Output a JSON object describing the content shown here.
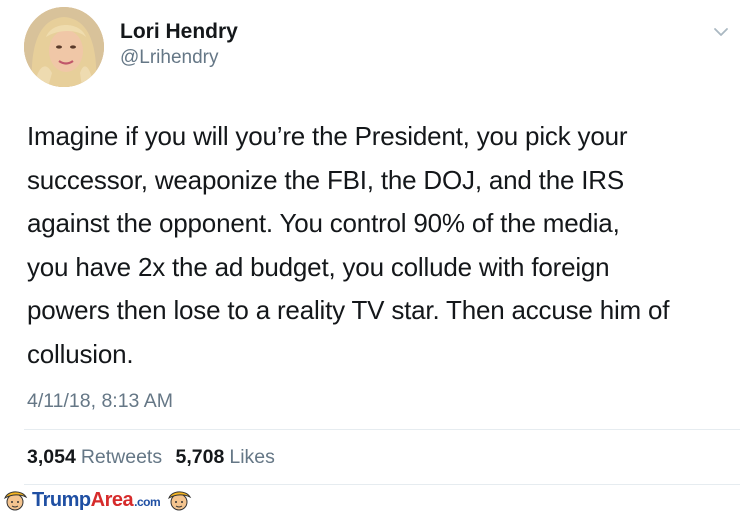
{
  "author": {
    "name": "Lori Hendry",
    "handle": "@Lrihendry"
  },
  "tweet": {
    "lines": [
      "Imagine if you will you’re the President, you pick your",
      "successor, weaponize the FBI, the DOJ, and the IRS",
      "against the opponent. You control 90% of the media,",
      "you have 2x the ad budget, you collude with foreign",
      "powers then lose to a reality TV star. Then accuse him of",
      "collusion."
    ],
    "timestamp": "4/11/18, 8:13 AM"
  },
  "stats": {
    "retweets_count": "3,054",
    "retweets_label": "Retweets",
    "likes_count": "5,708",
    "likes_label": "Likes"
  },
  "watermark": {
    "text_main": "Trump",
    "text_accent": "Area",
    "text_suffix": ".com"
  },
  "colors": {
    "primary_text": "#14171a",
    "secondary_text": "#657786",
    "divider": "#e6ecf0",
    "watermark_blue": "#1f4fa3",
    "watermark_red": "#d62b2b"
  },
  "icons": [
    "avatar-photo",
    "chevron-down-icon",
    "trump-face-icon"
  ]
}
